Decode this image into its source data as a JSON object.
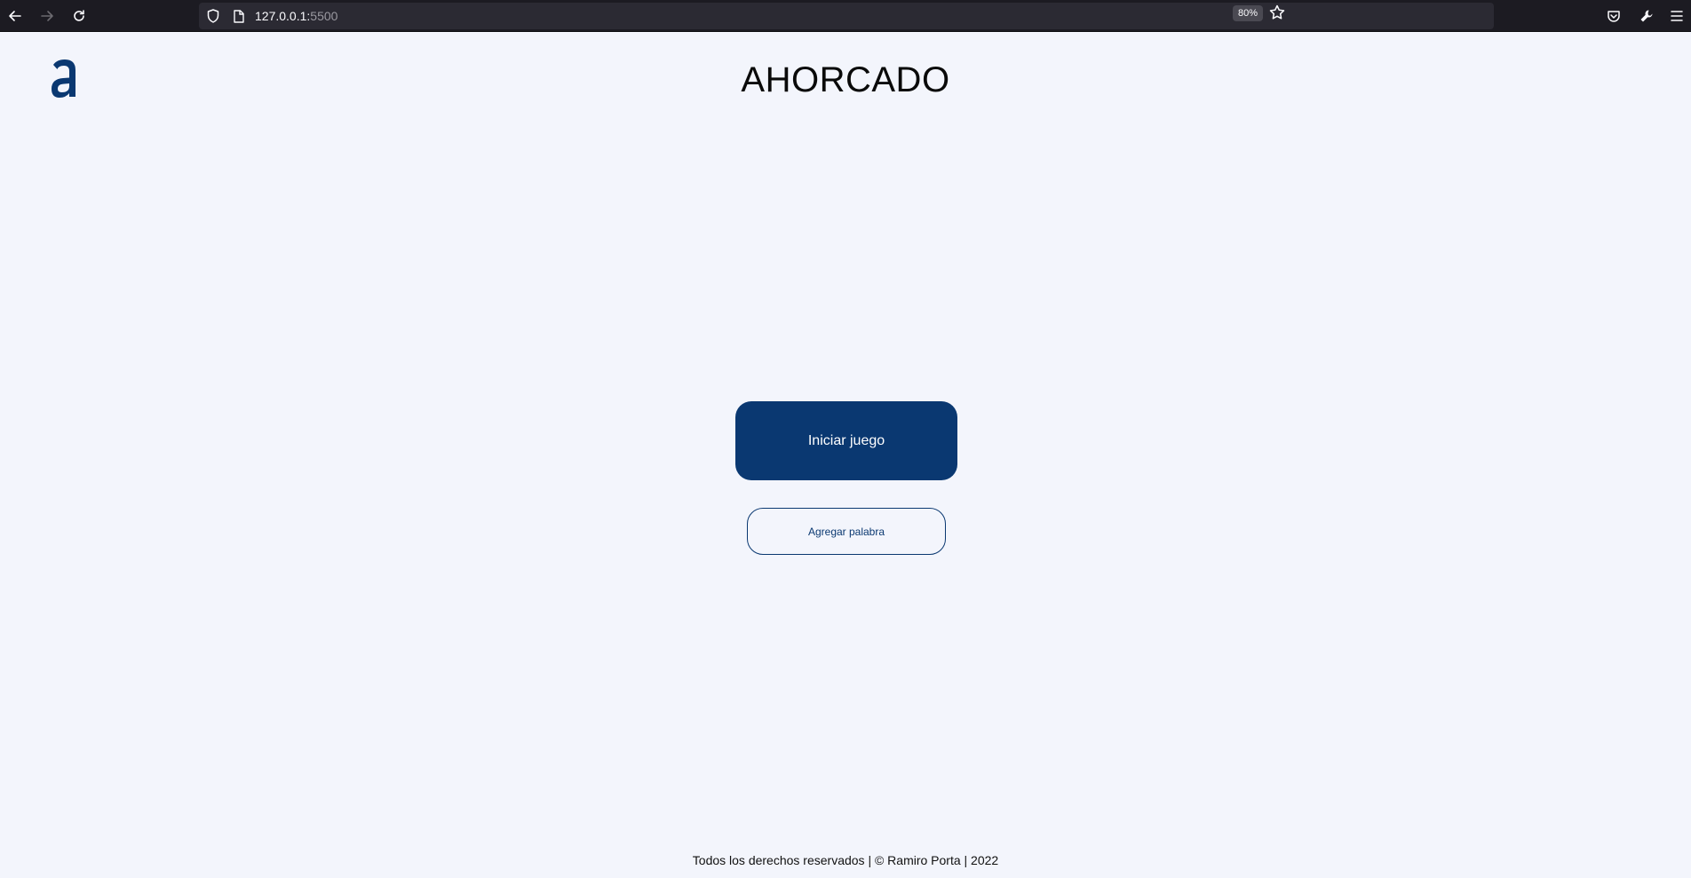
{
  "browser": {
    "url_host": "127.0.0.1:",
    "url_port": "5500",
    "zoom": "80%",
    "icons": [
      "back-arrow-icon",
      "forward-arrow-icon",
      "reload-icon",
      "shield-icon",
      "page-icon",
      "star-icon",
      "pocket-icon",
      "wrench-icon",
      "hamburger-menu-icon"
    ]
  },
  "header": {
    "logo_icon": "alura-a-logo",
    "title": "AHORCADO"
  },
  "main": {
    "start_label": "Iniciar juego",
    "add_word_label": "Agregar palabra"
  },
  "footer": {
    "text": "Todos los derechos reservados | © Ramiro Porta | 2022"
  },
  "colors": {
    "background": "#F3F5FC",
    "primary": "#0A3871",
    "text": "#0A0A0A",
    "browser_chrome": "#1C1B22",
    "url_bar": "#2B2A33"
  }
}
